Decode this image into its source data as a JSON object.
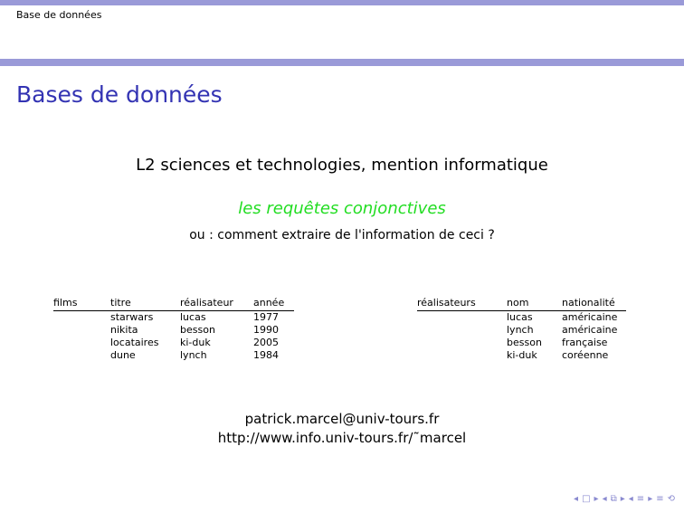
{
  "header": {
    "title": "Base de données"
  },
  "frame": {
    "title": "Bases de données"
  },
  "subtitle": "L2 sciences et technologies, mention informatique",
  "highlight": "les requêtes conjonctives",
  "question": "ou : comment extraire de l'information de ceci ?",
  "films": {
    "relation": "films",
    "columns": [
      "titre",
      "réalisateur",
      "année"
    ],
    "rows": [
      [
        "starwars",
        "lucas",
        "1977"
      ],
      [
        "nikita",
        "besson",
        "1990"
      ],
      [
        "locataires",
        "ki-duk",
        "2005"
      ],
      [
        "dune",
        "lynch",
        "1984"
      ]
    ]
  },
  "realisateurs": {
    "relation": "réalisateurs",
    "columns": [
      "nom",
      "nationalité"
    ],
    "rows": [
      [
        "lucas",
        "américaine"
      ],
      [
        "lynch",
        "américaine"
      ],
      [
        "besson",
        "française"
      ],
      [
        "ki-duk",
        "coréenne"
      ]
    ]
  },
  "contact": {
    "email": "patrick.marcel@univ-tours.fr",
    "url": "http://www.info.univ-tours.fr/˜marcel"
  },
  "nav": {
    "colors": {
      "bar": "#9a9ad8",
      "title": "#3333b3",
      "highlight": "#22dd22"
    },
    "icons": [
      "frame-prev-icon",
      "frame-icon",
      "frame-next-icon",
      "subsection-prev-icon",
      "subsection-icon",
      "subsection-next-icon",
      "section-prev-icon",
      "section-icon",
      "section-next-icon",
      "align-icon",
      "search-icon"
    ]
  }
}
